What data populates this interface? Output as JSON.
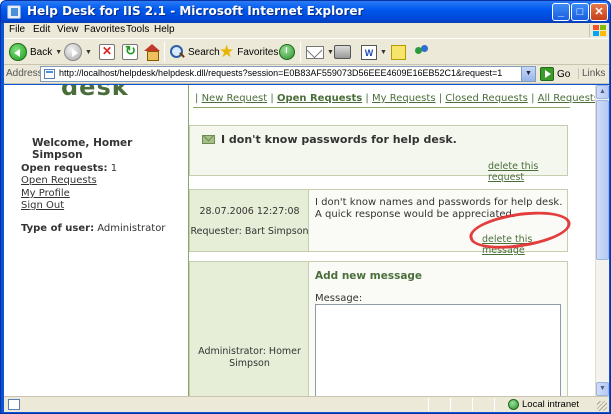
{
  "window": {
    "title": "Help Desk for IIS 2.1 - Microsoft Internet Explorer",
    "buttons": {
      "minimize": "_",
      "maximize": "□",
      "close": "✕"
    }
  },
  "menu": {
    "items": [
      "File",
      "Edit",
      "View",
      "Favorites",
      "Tools",
      "Help"
    ]
  },
  "toolbar": {
    "back_label": "Back",
    "search_label": "Search",
    "favorites_label": "Favorites"
  },
  "address": {
    "label": "Address",
    "url": "http://localhost/helpdesk/helpdesk.dll/requests?session=E0B83AF559073D56EEE4609E16EB52C1&request=1",
    "go_label": "Go",
    "links_label": "Links"
  },
  "sidebar": {
    "logo_fragment": "desk",
    "welcome": "Welcome, Homer Simpson",
    "open_requests_label": "Open requests:",
    "open_requests_count": "1",
    "links": [
      "Open Requests",
      "My Profile",
      "Sign Out"
    ],
    "user_type_label": "Type of user:",
    "user_type_value": "Administrator"
  },
  "nav": {
    "items": [
      "New Request",
      "Open Requests",
      "My Requests",
      "Closed Requests",
      "All Requests"
    ],
    "active": "Open Requests",
    "separator": "|"
  },
  "request": {
    "title": "I don't know passwords for help desk.",
    "delete_label": "delete this request"
  },
  "message": {
    "date": "28.07.2006 12:27:08",
    "requester": "Requester: Bart Simpson",
    "text_line1": "I don't know names and passwords for help desk.",
    "text_line2": "A quick response would be appreciated.",
    "delete_label": "delete this message",
    "highlight_color": "#e0282a"
  },
  "new_message": {
    "author_line1": "Administrator: Homer",
    "author_line2": "Simpson",
    "title": "Add new message",
    "message_label": "Message:",
    "message_value": ""
  },
  "status": {
    "zone": "Local intranet"
  },
  "colors": {
    "accent_green": "#4a6e3a",
    "panel_green": "#e7eed8",
    "titlebar_blue": "#0058ee"
  }
}
